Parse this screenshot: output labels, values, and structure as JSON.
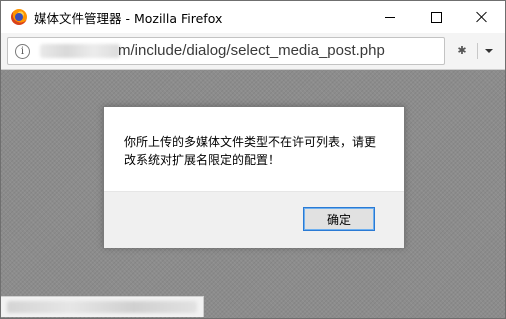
{
  "window": {
    "title": "媒体文件管理器 - Mozilla Firefox"
  },
  "urlbar": {
    "url_visible": "m/include/dialog/select_media_post.php",
    "info_icon_glyph": "i"
  },
  "icons": {
    "app": "firefox-icon",
    "info": "info-icon",
    "extension": "extension-icon",
    "menu": "chevron-down-icon"
  },
  "dialog": {
    "message": "你所上传的多媒体文件类型不在许可列表，请更改系统对扩展名限定的配置！",
    "ok_label": "确定"
  },
  "colors": {
    "overlay": "#8c8c8c",
    "button_focus_border": "#2a7ad4"
  }
}
